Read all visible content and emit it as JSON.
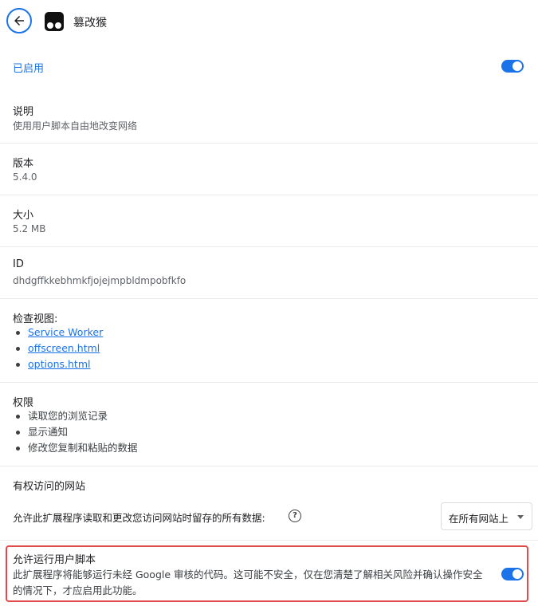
{
  "header": {
    "extension_name": "篡改猴"
  },
  "enabled": {
    "label": "已启用",
    "on": true
  },
  "description": {
    "label": "说明",
    "value": "使用用户脚本自由地改变网络"
  },
  "version": {
    "label": "版本",
    "value": "5.4.0"
  },
  "size": {
    "label": "大小",
    "value": "5.2 MB"
  },
  "id": {
    "label": "ID",
    "value": "dhdgffkkebhmkfjojejmpbldmpobfkfo"
  },
  "inspect_views": {
    "label": "检查视图:",
    "links": [
      "Service Worker",
      "offscreen.html",
      "options.html"
    ]
  },
  "permissions": {
    "label": "权限",
    "items": [
      "读取您的浏览记录",
      "显示通知",
      "修改您复制和粘贴的数据"
    ]
  },
  "site_access": {
    "title": "有权访问的网站",
    "prompt": "允许此扩展程序读取和更改您访问网站时留存的所有数据:",
    "selected_option": "在所有网站上"
  },
  "user_scripts": {
    "title": "允许运行用户脚本",
    "description": "此扩展程序将能够运行未经 Google 审核的代码。这可能不安全，仅在您清楚了解相关风险并确认操作安全的情况下，才应启用此功能。",
    "on": true
  },
  "colors": {
    "accent": "#1a73e8",
    "highlight_border": "#e04b4b"
  }
}
